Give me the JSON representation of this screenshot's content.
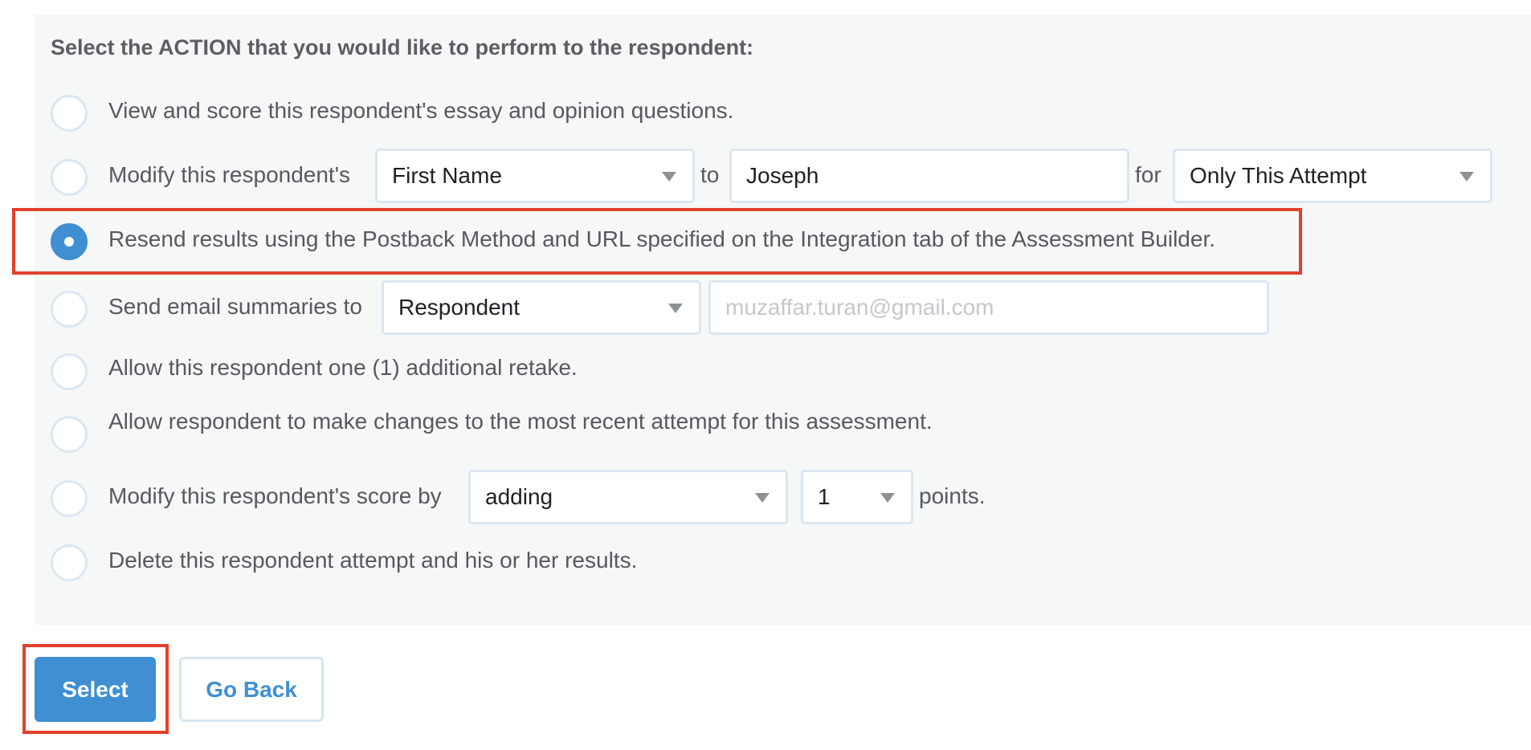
{
  "heading": "Select the ACTION that you would like to perform to the respondent:",
  "options": {
    "view_score": {
      "label": "View and score this respondent's essay and opinion questions.",
      "checked": false
    },
    "modify_field": {
      "label_before": "Modify this respondent's",
      "field_select": "First Name",
      "label_to": "to",
      "value": "Joseph",
      "label_for": "for",
      "scope_select": "Only This Attempt",
      "checked": false
    },
    "resend": {
      "label": "Resend results using the Postback Method and URL specified on the Integration tab of the Assessment Builder.",
      "checked": true
    },
    "email": {
      "label": "Send email summaries to",
      "recipient_select": "Respondent",
      "email_placeholder": "muzaffar.turan@gmail.com",
      "checked": false
    },
    "retake": {
      "label": "Allow this respondent one (1) additional retake.",
      "checked": false
    },
    "changes": {
      "label": "Allow respondent to make changes to the most recent attempt for this assessment.",
      "checked": false
    },
    "modify_score": {
      "label": "Modify this respondent's score by",
      "operation_select": "adding",
      "amount_select": "1",
      "label_after": "points.",
      "checked": false
    },
    "delete": {
      "label": "Delete this respondent attempt and his or her results.",
      "checked": false
    }
  },
  "buttons": {
    "select": "Select",
    "go_back": "Go Back"
  },
  "colors": {
    "accent": "#3f8fd2",
    "highlight": "#e2412d",
    "panel": "#f6f7f7"
  }
}
